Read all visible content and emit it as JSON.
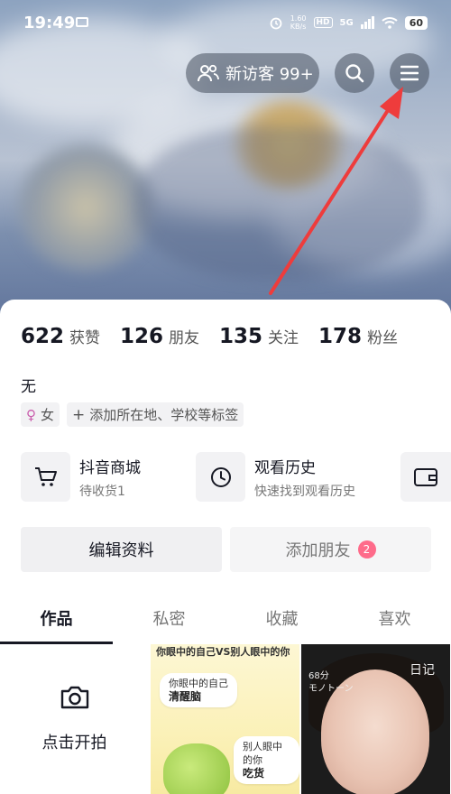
{
  "status_bar": {
    "time": "19:49",
    "speed_value": "1.60",
    "speed_unit": "KB/s",
    "hd": "HD",
    "network": "5G",
    "battery": "60"
  },
  "header": {
    "visitors_label": "新访客 99+",
    "search_icon": "search-icon",
    "menu_icon": "menu-icon",
    "arrow_color": "#ee3c3c"
  },
  "stats": [
    {
      "value": "622",
      "label": "获赞"
    },
    {
      "value": "126",
      "label": "朋友"
    },
    {
      "value": "135",
      "label": "关注"
    },
    {
      "value": "178",
      "label": "粉丝"
    }
  ],
  "bio": "无",
  "tags": {
    "gender_symbol": "♀",
    "gender": "女",
    "add_symbol": "+",
    "add_tag": "添加所在地、学校等标签"
  },
  "shortcuts": [
    {
      "icon": "cart-icon",
      "title": "抖音商城",
      "subtitle": "待收货1"
    },
    {
      "icon": "clock-icon",
      "title": "观看历史",
      "subtitle": "快速找到观看历史"
    }
  ],
  "actions": {
    "edit": "编辑资料",
    "add_friends": "添加朋友",
    "add_friends_badge": "2"
  },
  "tabs": [
    "作品",
    "私密",
    "收藏",
    "喜欢"
  ],
  "grid": {
    "camera_label": "点击开拍",
    "thumb1_top": "你眼中的自己VS别人眼中的你",
    "thumb1_bubble1_line1": "你眼中的自己",
    "thumb1_bubble1_line2": "清醒脑",
    "thumb1_bubble2_line1": "别人眼中的你",
    "thumb1_bubble2_line2": "吃货",
    "thumb2_label1": "日记",
    "thumb2_label2": "68分",
    "thumb2_label3": "モノトーン"
  }
}
